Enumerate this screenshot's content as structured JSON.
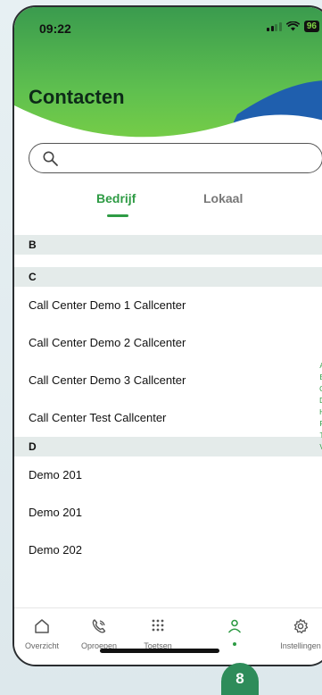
{
  "status": {
    "time": "09:22",
    "battery": "96"
  },
  "header": {
    "title": "Contacten"
  },
  "search": {
    "placeholder": ""
  },
  "tabs": [
    {
      "label": "Bedrijf",
      "active": true
    },
    {
      "label": "Lokaal",
      "active": false
    }
  ],
  "sections": [
    {
      "letter": "B",
      "rows": []
    },
    {
      "letter": "C",
      "rows": [
        "Call Center Demo 1 Callcenter",
        "Call Center Demo 2 Callcenter",
        "Call Center Demo 3 Callcenter",
        "Call Center Test Callcenter"
      ]
    },
    {
      "letter": "D",
      "rows": [
        "Demo 201",
        "Demo 201",
        "Demo 202"
      ]
    }
  ],
  "index_letters": [
    "A",
    "B",
    "C",
    "D",
    "H",
    "P",
    "T",
    "V"
  ],
  "nav": [
    {
      "label": "Overzicht",
      "icon": "home-icon",
      "active": false
    },
    {
      "label": "Oproepen",
      "icon": "phone-icon",
      "active": false
    },
    {
      "label": "Toetsen",
      "icon": "keypad-icon",
      "active": false
    },
    {
      "label": "",
      "icon": "person-icon",
      "active": true
    },
    {
      "label": "Instellingen",
      "icon": "gear-icon",
      "active": false
    }
  ],
  "badge": "8",
  "colors": {
    "accent": "#2e9b44",
    "header_green": "#5fc04f",
    "wave_blue": "#1f5fae"
  }
}
